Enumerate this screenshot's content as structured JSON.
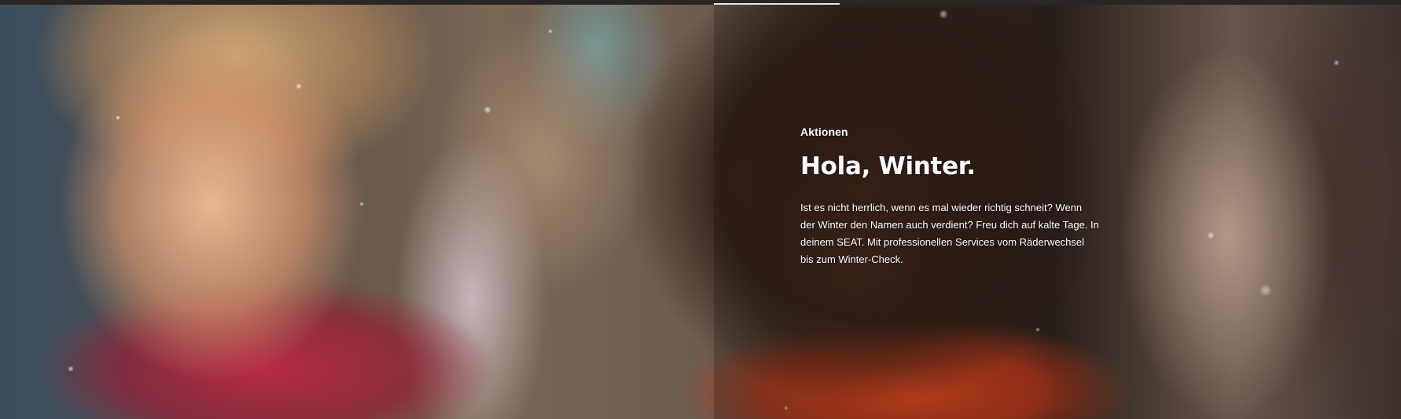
{
  "hero": {
    "slide_progress_percent": 9,
    "eyebrow": "Aktionen",
    "headline": "Hola, Winter.",
    "body": "Ist es nicht herrlich, wenn es mal wieder richtig schneit? Wenn der Winter den Namen auch verdient? Freu dich auf kalte Tage. In deinem SEAT. Mit professionellen Services vom Räderwechsel bis zum Winter-Check.",
    "colors": {
      "text": "#ffffff",
      "progress_fill": "#e9e6e2",
      "top_strip": "#2a2623"
    }
  }
}
